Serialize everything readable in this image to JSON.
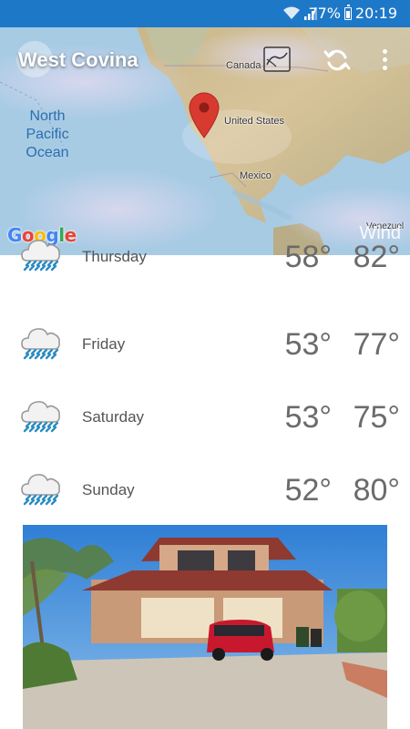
{
  "status_bar": {
    "battery": "77%",
    "time": "20:19",
    "icons": [
      "wifi-icon",
      "signal-icon",
      "battery-icon"
    ]
  },
  "header": {
    "city": "West Covina",
    "icons": [
      "layers-icon",
      "refresh-icon",
      "more-vert-icon"
    ]
  },
  "map": {
    "labels": {
      "canada": "Canada",
      "us": "United States",
      "mexico": "Mexico",
      "venezuela": "Venezuel",
      "ocean": "North Pacific Ocean"
    },
    "google": "Google",
    "layer": "Wind"
  },
  "forecast": [
    {
      "day": "Thursday",
      "low": "58°",
      "high": "82°",
      "icon": "rain-cloud-icon"
    },
    {
      "day": "Friday",
      "low": "53°",
      "high": "77°",
      "icon": "rain-cloud-icon"
    },
    {
      "day": "Saturday",
      "low": "53°",
      "high": "75°",
      "icon": "rain-cloud-icon"
    },
    {
      "day": "Sunday",
      "low": "52°",
      "high": "80°",
      "icon": "rain-cloud-icon"
    }
  ],
  "colors": {
    "status_bar": "#1e78c8",
    "rain_drops": "#2b8cc4",
    "pin": "#d93a2f"
  }
}
